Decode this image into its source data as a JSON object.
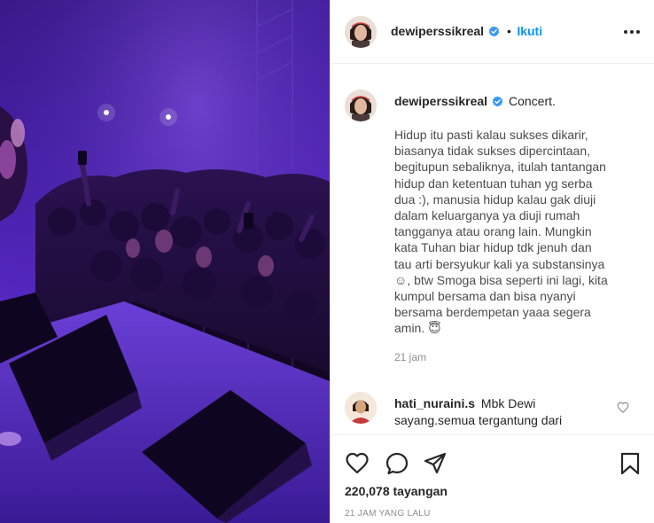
{
  "post": {
    "author": "dewiperssikreal",
    "follow_label": "Ikuti",
    "separator": "•",
    "caption_title": "Concert.",
    "caption_lines": [
      "Hidup itu pasti kalau sukses dikarir,",
      "biasanya tidak sukses dipercintaan,",
      "begitupun sebaliknya, itulah tantangan",
      "hidup dan ketentuan tuhan yg serba",
      "dua :), manusia hidup kalau gak diuji",
      "dalam keluarganya ya diuji rumah",
      "tangganya atau orang lain. Mungkin",
      "kata Tuhan biar hidup tdk jenuh dan",
      "tau arti bersyukur kali ya substansinya",
      "☺, btw Smoga bisa seperti ini lagi, kita",
      "kumpul bersama dan bisa nyanyi",
      "bersama berdempetan yaaa segera",
      "amin. 😇"
    ],
    "caption_time": "21 jam"
  },
  "comment": {
    "author": "hati_nuraini.s",
    "text_line1": "Mbk Dewi",
    "text_line2": "sayang.semua tergantung dari"
  },
  "stats": {
    "views": "220,078 tayangan",
    "posted": "21 JAM YANG LALU"
  },
  "icons": {
    "verified": "verified-badge-icon",
    "more": "more-options-icon",
    "like": "heart-icon",
    "comment": "comment-bubble-icon",
    "share": "paper-plane-icon",
    "save": "bookmark-icon",
    "comment_like": "small-heart-icon"
  },
  "colors": {
    "accent": "#0095f6",
    "verified": "#3897f0",
    "muted": "#8e8e8e"
  }
}
